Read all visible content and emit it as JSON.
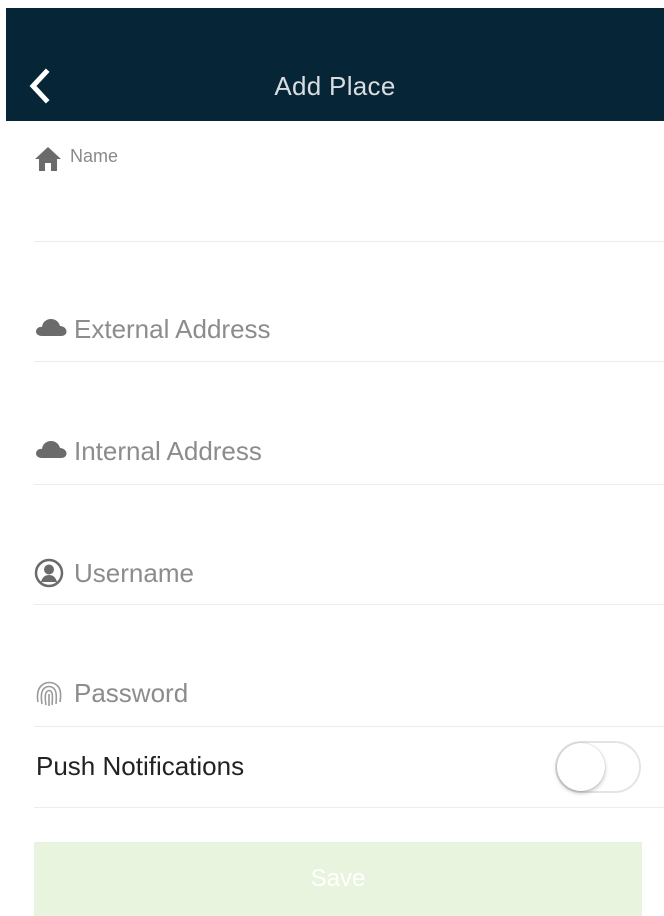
{
  "header": {
    "title": "Add Place",
    "back_icon": "chevron-left-icon",
    "background_color": "#062536"
  },
  "form": {
    "name": {
      "label": "Name",
      "value": "",
      "icon": "home-icon"
    },
    "external_address": {
      "placeholder": "External Address",
      "value": "",
      "icon": "cloud-icon"
    },
    "internal_address": {
      "placeholder": "Internal Address",
      "value": "",
      "icon": "cloud-icon"
    },
    "username": {
      "placeholder": "Username",
      "value": "",
      "icon": "user-icon"
    },
    "password": {
      "placeholder": "Password",
      "value": "",
      "icon": "fingerprint-icon"
    },
    "push_notifications": {
      "label": "Push Notifications",
      "enabled": false
    }
  },
  "save_button": {
    "label": "Save",
    "enabled": false,
    "background_color": "#e8f4de"
  }
}
